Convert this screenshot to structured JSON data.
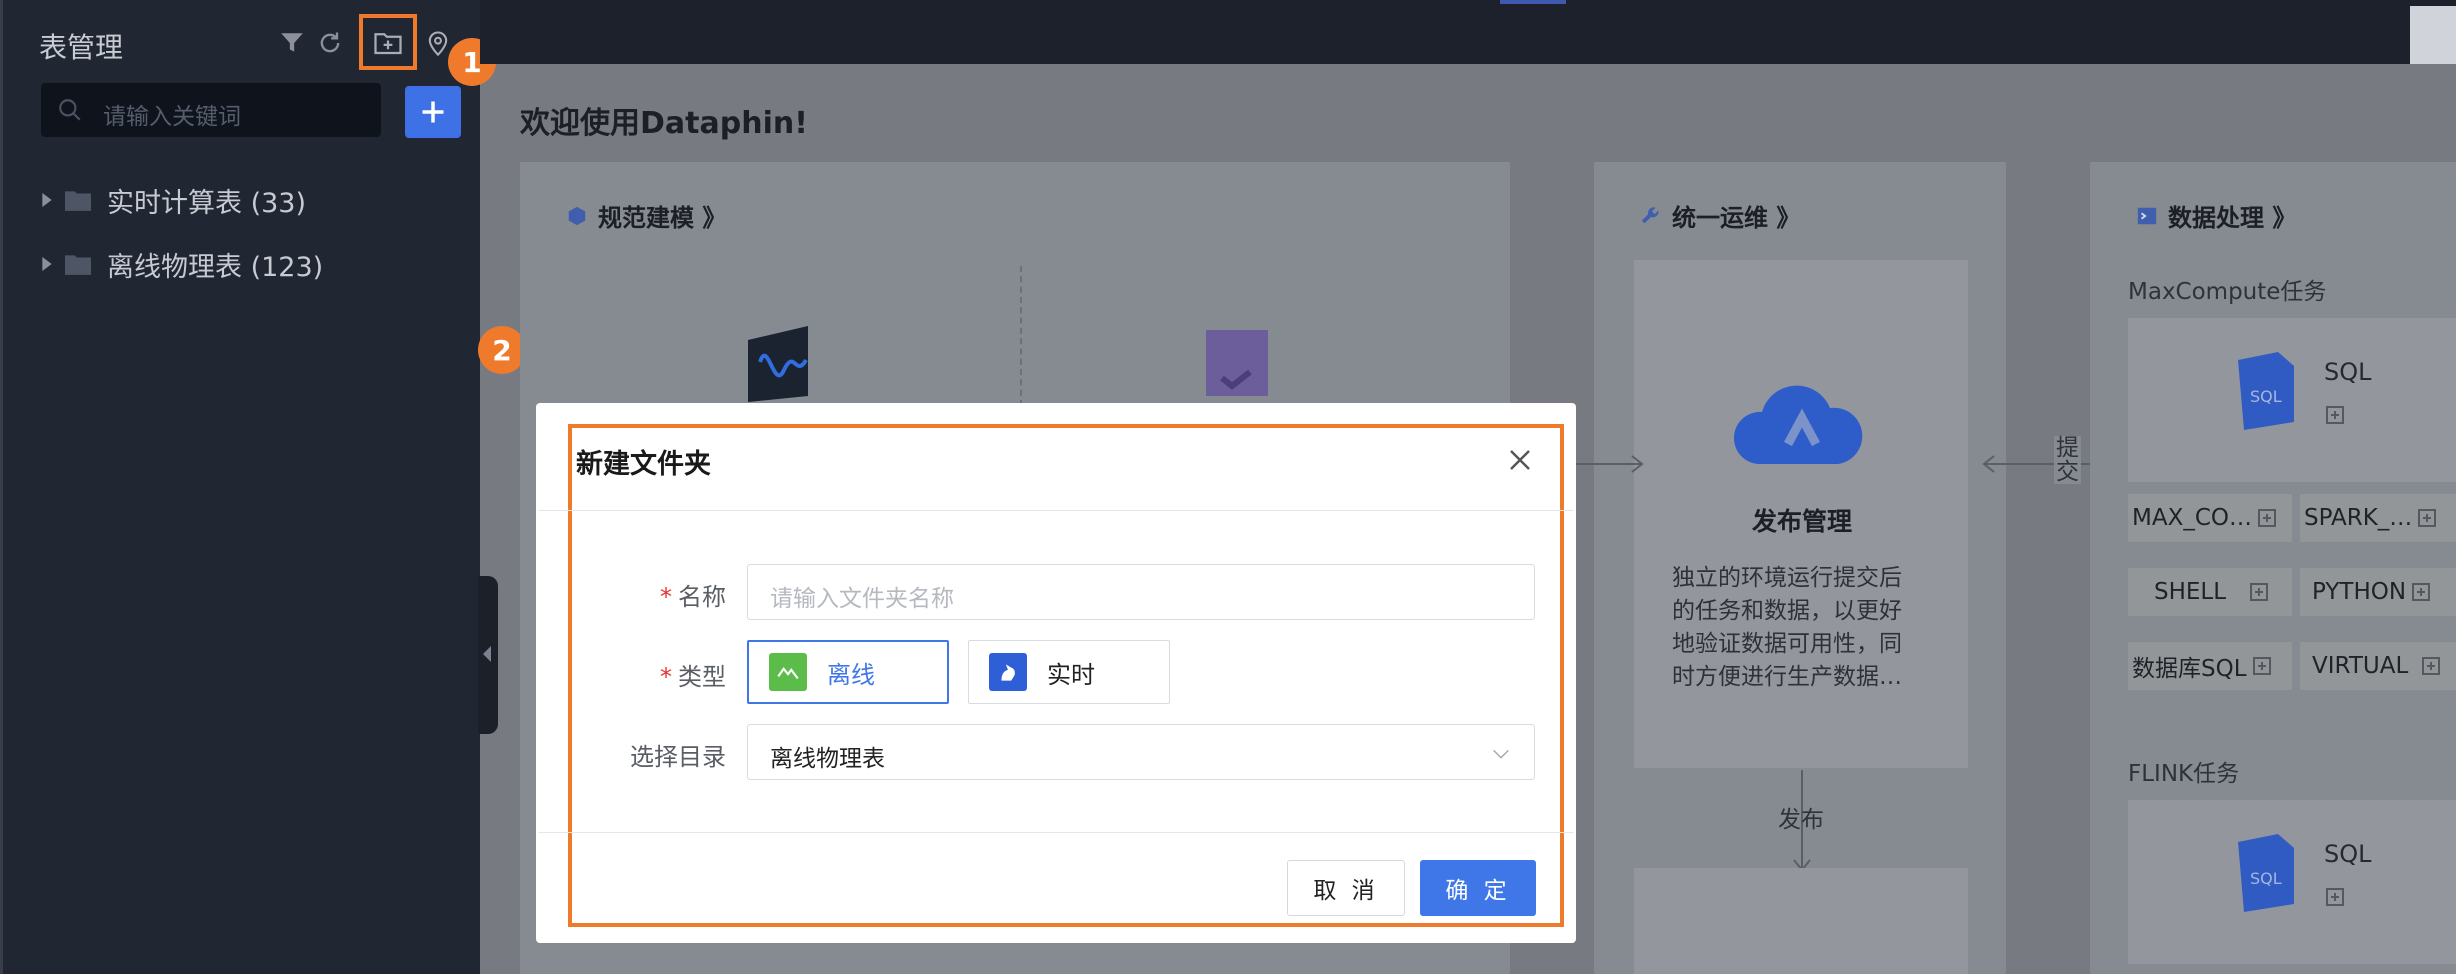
{
  "sidebar": {
    "title": "表管理",
    "search_placeholder": "请输入关键词",
    "tree": [
      {
        "label": "实时计算表 (33)"
      },
      {
        "label": "离线物理表 (123)"
      }
    ]
  },
  "callouts": [
    "1",
    "2"
  ],
  "main": {
    "welcome": "欢迎使用Dataphin!",
    "panel_modeling": {
      "title": "规范建模 》"
    },
    "panel_ops": {
      "title": "统一运维 》",
      "card_title": "发布管理",
      "card_desc": [
        "独立的环境运行提交后",
        "的任务和数据，以更好",
        "地验证数据可用性，同",
        "时方便进行生产数据…"
      ],
      "arrow_label": "发布",
      "submit_label": [
        "提",
        "交"
      ]
    },
    "panel_data": {
      "title": "数据处理 》",
      "maxcompute_label": "MaxCompute任务",
      "sql_label": "SQL",
      "tasks": [
        "MAX_CO…",
        "SPARK_…",
        "SHELL",
        "PYTHON",
        "数据库SQL",
        "VIRTUAL"
      ],
      "flink_label": "FLINK任务",
      "flink_sql_label": "SQL"
    }
  },
  "modal": {
    "title": "新建文件夹",
    "name_label": "名称",
    "name_placeholder": "请输入文件夹名称",
    "type_label": "类型",
    "types": [
      {
        "label": "离线",
        "selected": true
      },
      {
        "label": "实时",
        "selected": false
      }
    ],
    "dir_label": "选择目录",
    "dir_value": "离线物理表",
    "required_mark": "*",
    "cancel": "取 消",
    "confirm": "确 定"
  },
  "colors": {
    "accent": "#3f76e8",
    "highlight": "#f07a2b",
    "sidebar_bg": "#212633"
  }
}
